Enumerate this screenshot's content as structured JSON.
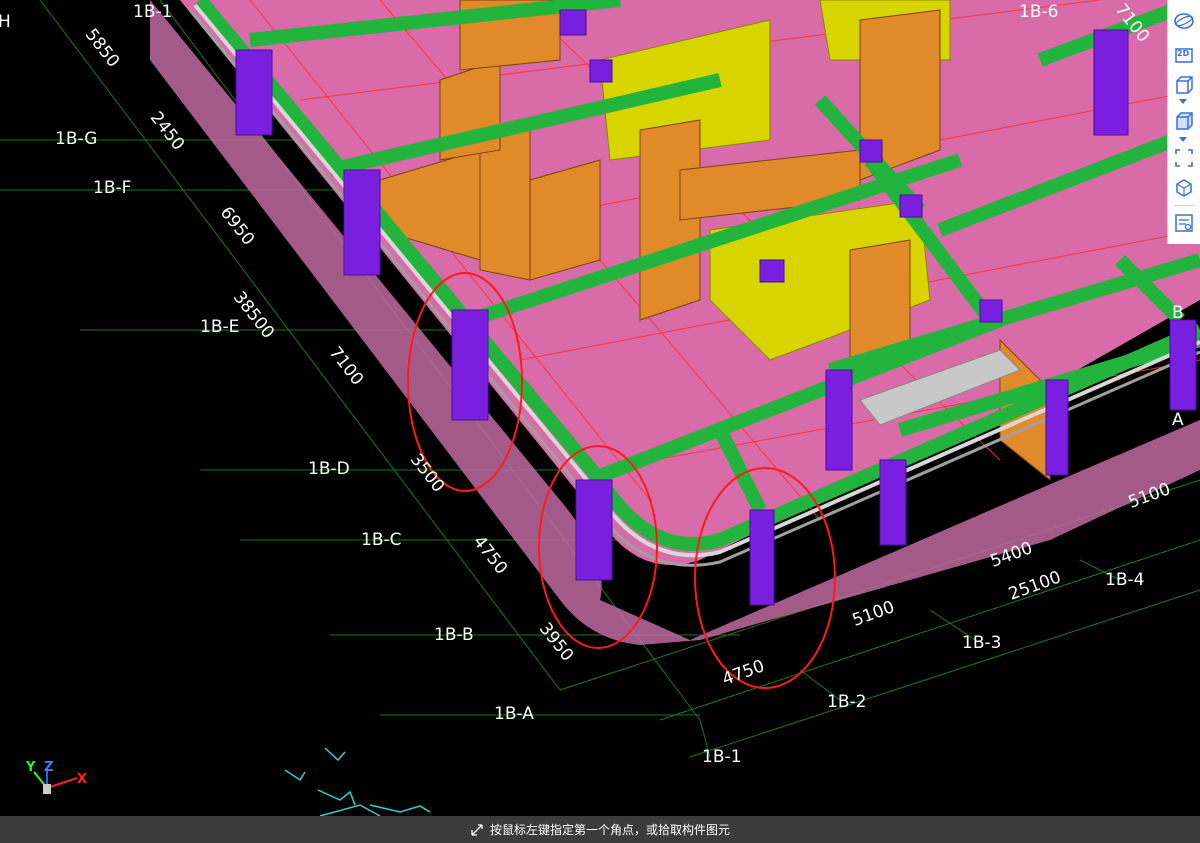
{
  "grid_axes": {
    "left_column": [
      {
        "id": "axis-1bh",
        "label": "H"
      },
      {
        "id": "axis-1bg",
        "label": "1B-G"
      },
      {
        "id": "axis-1bf",
        "label": "1B-F"
      },
      {
        "id": "axis-1be",
        "label": "1B-E"
      },
      {
        "id": "axis-1bd",
        "label": "1B-D"
      },
      {
        "id": "axis-1bc",
        "label": "1B-C"
      },
      {
        "id": "axis-1bb",
        "label": "1B-B"
      },
      {
        "id": "axis-1ba",
        "label": "1B-A"
      }
    ],
    "bottom_row": [
      {
        "id": "axis-1b1",
        "label": "1B-1"
      },
      {
        "id": "axis-1b2",
        "label": "1B-2"
      },
      {
        "id": "axis-1b3",
        "label": "1B-3"
      },
      {
        "id": "axis-1b4",
        "label": "1B-4"
      }
    ],
    "top_row": [
      {
        "id": "axis-1b1-top",
        "label": "1B-1"
      },
      {
        "id": "axis-1b6-top",
        "label": "1B-6"
      }
    ],
    "right_edge": [
      {
        "id": "axis-b-right",
        "label": "B"
      },
      {
        "id": "axis-a-right",
        "label": "A"
      }
    ]
  },
  "dimensions": {
    "left": [
      "5850",
      "2450",
      "6950",
      "38500",
      "7100",
      "3500",
      "4750",
      "3950"
    ],
    "bottom": [
      "4750",
      "5100",
      "5400",
      "25100",
      "5100"
    ],
    "top": [
      "7100"
    ]
  },
  "colors": {
    "background": "#000000",
    "slab": "#d96ba8",
    "beam": "#22b43c",
    "column": "#7a1fe0",
    "wall": "#e08a2a",
    "wall_yellow": "#d8d400",
    "grid_line": "#1a7a1a",
    "grid_red": "#ff2020",
    "highlight_circle": "#ff1a1a"
  },
  "toolbar": {
    "tools": [
      "sphere-view-icon",
      "2d-view-icon",
      "box-view-icon",
      "solid-box-icon",
      "marquee-select-icon",
      "component-filter-icon",
      "property-list-icon"
    ],
    "view_2d_label": "2D"
  },
  "gizmo": {
    "x": "X",
    "y": "Y",
    "z": "Z"
  },
  "status": {
    "message": "按鼠标左键指定第一个角点，或拾取构件图元"
  }
}
